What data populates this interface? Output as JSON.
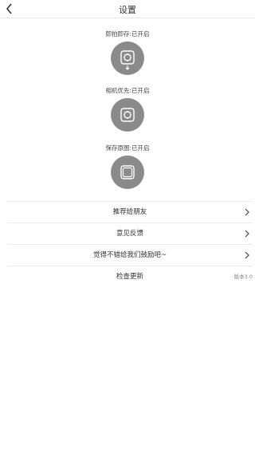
{
  "header": {
    "title": "设置"
  },
  "modes": [
    {
      "label": "即拍即存:已开启",
      "icon": "camera-save-icon"
    },
    {
      "label": "相机优先:已开启",
      "icon": "camera-icon"
    },
    {
      "label": "保存原图:已开启",
      "icon": "original-image-icon"
    }
  ],
  "menu": {
    "recommend": "推荐给朋友",
    "feedback": "意见反馈",
    "encourage": "觉得不错给我们鼓励吧~",
    "update": "检查更新",
    "version": "版本3.0"
  },
  "colors": {
    "toggle_bg": "#8a8a8a",
    "divider": "#ececec"
  }
}
